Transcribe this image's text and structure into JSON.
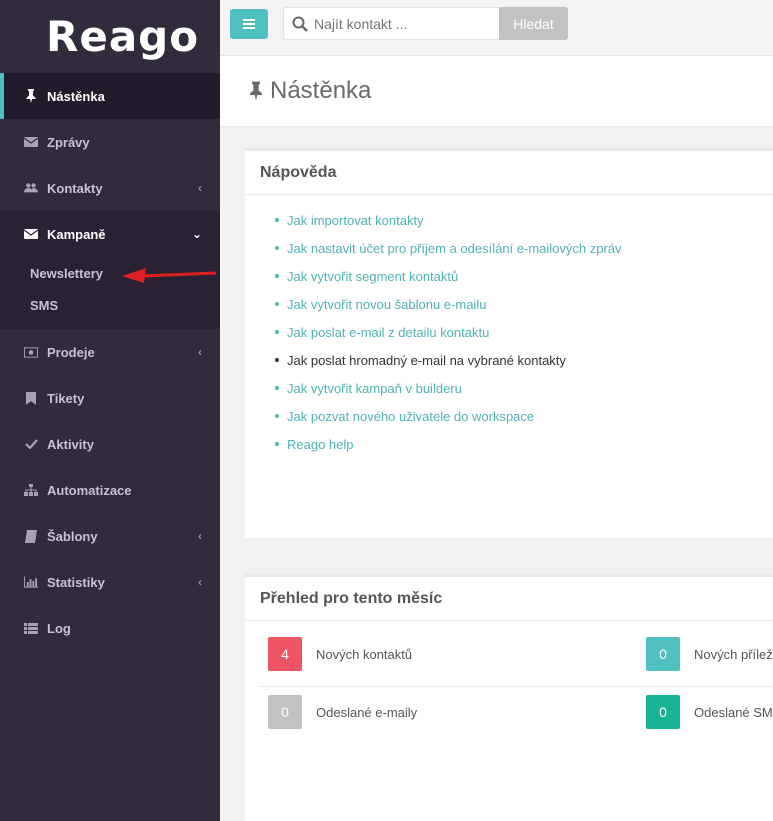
{
  "app": {
    "logo_text": "Reago"
  },
  "sidebar": {
    "items": [
      {
        "label": "Nástěnka",
        "icon": "pin-icon",
        "active": true
      },
      {
        "label": "Zprávy",
        "icon": "envelope-icon"
      },
      {
        "label": "Kontakty",
        "icon": "users-icon",
        "has_chevron": true
      },
      {
        "label": "Kampaně",
        "icon": "envelope-icon",
        "open": true,
        "sub": [
          "Newslettery",
          "SMS"
        ]
      },
      {
        "label": "Prodeje",
        "icon": "money-icon",
        "has_chevron": true
      },
      {
        "label": "Tikety",
        "icon": "bookmark-icon"
      },
      {
        "label": "Aktivity",
        "icon": "check-icon"
      },
      {
        "label": "Automatizace",
        "icon": "sitemap-icon"
      },
      {
        "label": "Šablony",
        "icon": "book-icon",
        "has_chevron": true
      },
      {
        "label": "Statistiky",
        "icon": "bar-chart-icon",
        "has_chevron": true
      },
      {
        "label": "Log",
        "icon": "list-icon"
      }
    ]
  },
  "topbar": {
    "search_placeholder": "Najít kontakt ...",
    "search_button": "Hledat"
  },
  "page": {
    "title": "Nástěnka"
  },
  "help_panel": {
    "title": "Nápověda",
    "links": [
      "Jak importovat kontakty",
      "Jak nastavit účet pro příjem a odesílání e-mailových zpráv",
      "Jak vytvořit segment kontaktů",
      "Jak vytvořit novou šablonu e-mailu",
      "Jak poslat e-mail z detailu kontaktu",
      "Jak poslat hromadný e-mail na vybrané kontakty",
      "Jak vytvořit kampaň v builderu",
      "Jak pozvat nového uživatele do workspace",
      "Reago help"
    ]
  },
  "month_panel": {
    "title": "Přehled pro tento měsíc",
    "stats": [
      {
        "value": "4",
        "label": "Nových kontaktů",
        "color": "#ed5565"
      },
      {
        "value": "0",
        "label": "Nových přílež",
        "color": "#4fbfbf"
      },
      {
        "value": "0",
        "label": "Odeslané e-maily",
        "color": "#c2c2c2"
      },
      {
        "value": "0",
        "label": "Odeslané SM",
        "color": "#1ab394"
      }
    ]
  },
  "colors": {
    "sidebar_bg": "#322a3d",
    "accent": "#4fbfbf",
    "link": "#4fb3b6",
    "annotation_arrow": "#e02020"
  }
}
